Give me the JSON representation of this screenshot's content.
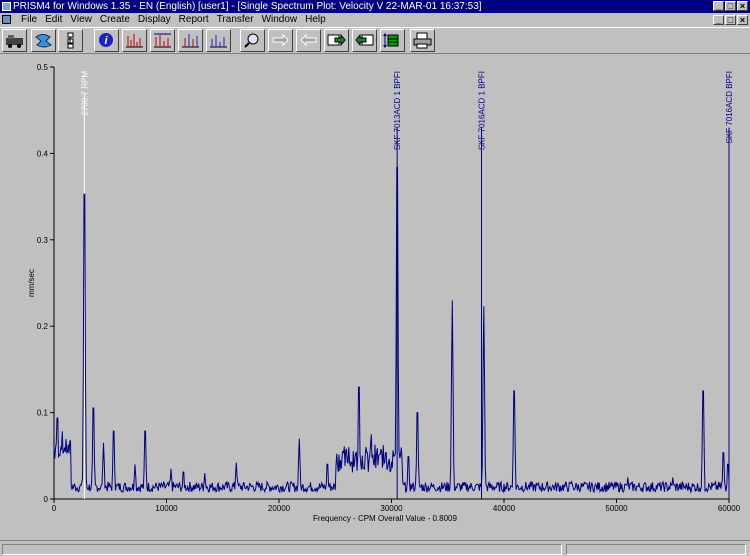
{
  "window": {
    "title": "PRISM4 for Windows 1.35 - EN (English) [user1] - [Single Spectrum Plot: Velocity V 22-MAR-01 16:37:53]",
    "buttons": [
      "_",
      "□",
      "×"
    ]
  },
  "menu": {
    "items": [
      "File",
      "Edit",
      "View",
      "Create",
      "Display",
      "Report",
      "Transfer",
      "Window",
      "Help"
    ],
    "doc_buttons": [
      "_",
      "□",
      "×"
    ]
  },
  "toolbar": {
    "buttons": [
      {
        "name": "machine-train-icon",
        "enabled": true
      },
      {
        "name": "route-icon",
        "enabled": true
      },
      {
        "name": "hierarchy-icon",
        "enabled": true
      },
      {
        "name": "info-icon",
        "enabled": true
      },
      {
        "name": "spectrum-red-icon",
        "enabled": true
      },
      {
        "name": "spectrum-multi-icon",
        "enabled": true
      },
      {
        "name": "spectrum-waterfall-icon",
        "enabled": true
      },
      {
        "name": "spectrum-blue-icon",
        "enabled": true
      },
      {
        "name": "zoom-icon",
        "enabled": true
      },
      {
        "name": "arrow-right-disabled-icon",
        "enabled": false
      },
      {
        "name": "arrow-left-disabled-icon",
        "enabled": false
      },
      {
        "name": "next-icon",
        "enabled": true
      },
      {
        "name": "previous-icon",
        "enabled": true
      },
      {
        "name": "data-grid-icon",
        "enabled": true
      },
      {
        "name": "print-icon",
        "enabled": true
      }
    ]
  },
  "chart_data": {
    "type": "line",
    "xlabel": "Frequency - CPM  Overall Value - 0.8009",
    "ylabel": "mm/sec",
    "xlim": [
      0,
      60000
    ],
    "ylim": [
      0,
      0.5
    ],
    "x_ticks": [
      "0",
      "10000",
      "20000",
      "30000",
      "40000",
      "50000",
      "60000"
    ],
    "y_ticks": [
      "0",
      "0.1",
      "0.2",
      "0.3",
      "0.4",
      "0.5"
    ],
    "colors": {
      "line": "#000080",
      "marker": "#ffffff",
      "background": "#c0c0c0"
    },
    "markers": [
      {
        "x": 2700,
        "label": "2708.7 RPM",
        "color": "#ffffff"
      },
      {
        "x": 30500,
        "label": "SKF 7013ACD 1 BPFI",
        "color": "#000080"
      },
      {
        "x": 38000,
        "label": "SKF 7016ACD 1 BPFI",
        "color": "#000080"
      },
      {
        "x": 60000,
        "label": "SKF 7016ACD BPFI",
        "color": "#000080"
      }
    ],
    "peaks": [
      [
        300,
        0.105
      ],
      [
        700,
        0.065
      ],
      [
        1100,
        0.06
      ],
      [
        2700,
        0.395
      ],
      [
        3500,
        0.118
      ],
      [
        4400,
        0.065
      ],
      [
        5300,
        0.088
      ],
      [
        7200,
        0.04
      ],
      [
        8100,
        0.088
      ],
      [
        10400,
        0.035
      ],
      [
        11500,
        0.035
      ],
      [
        13400,
        0.03
      ],
      [
        16200,
        0.042
      ],
      [
        21800,
        0.07
      ],
      [
        24300,
        0.045
      ],
      [
        26200,
        0.06
      ],
      [
        27100,
        0.145
      ],
      [
        28200,
        0.075
      ],
      [
        29500,
        0.06
      ],
      [
        30500,
        0.43
      ],
      [
        31500,
        0.055
      ],
      [
        32300,
        0.112
      ],
      [
        35400,
        0.23
      ],
      [
        38200,
        0.223
      ],
      [
        40900,
        0.14
      ],
      [
        46000,
        0.02
      ],
      [
        51000,
        0.025
      ],
      [
        55000,
        0.025
      ],
      [
        57700,
        0.14
      ],
      [
        59500,
        0.06
      ],
      [
        59900,
        0.045
      ]
    ]
  },
  "status": {
    "panes": [
      "",
      ""
    ]
  }
}
